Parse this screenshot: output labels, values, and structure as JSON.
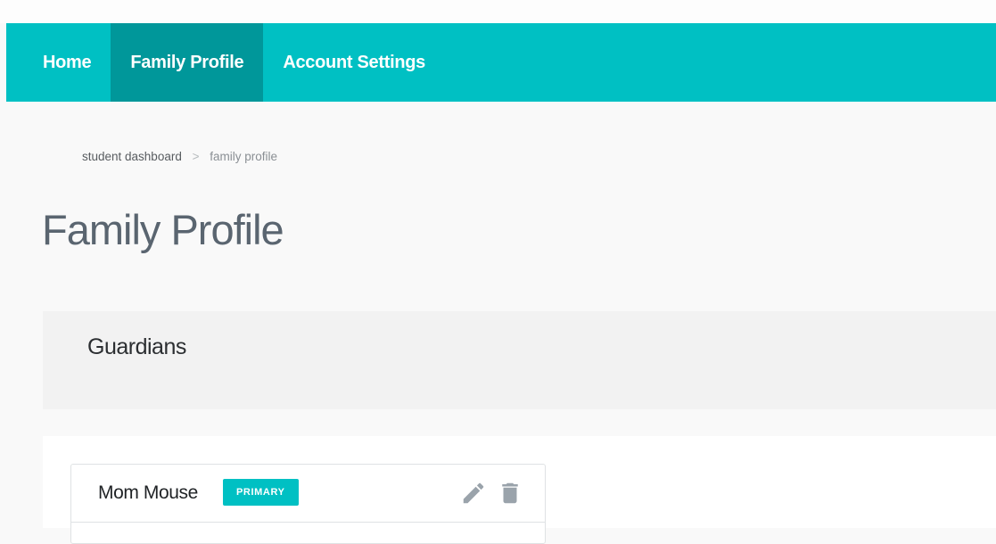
{
  "nav": {
    "items": [
      {
        "label": "Home",
        "active": false
      },
      {
        "label": "Family Profile",
        "active": true
      },
      {
        "label": "Account Settings",
        "active": false
      }
    ]
  },
  "breadcrumb": {
    "items": [
      "student dashboard",
      "family profile"
    ],
    "separator": ">"
  },
  "page": {
    "title": "Family Profile"
  },
  "guardians": {
    "section_title": "Guardians",
    "list": [
      {
        "name": "Mom Mouse",
        "badge": "PRIMARY",
        "actions": [
          "pencil-icon",
          "trash-icon"
        ]
      }
    ]
  },
  "colors": {
    "brand": "#00c0c3",
    "nav_active": "#00979a",
    "icon_gray": "#9aa3ab",
    "page_bg": "#f9f9f9"
  }
}
